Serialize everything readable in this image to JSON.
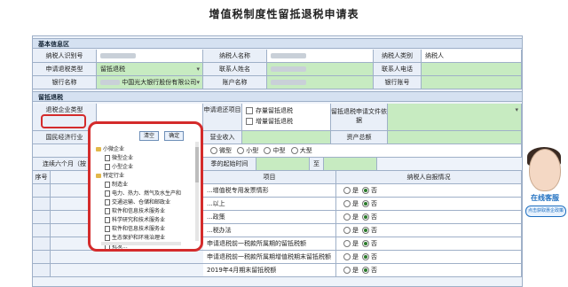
{
  "title": "增值税制度性留抵退税申请表",
  "section_basic": "基本信息区",
  "row1": {
    "l1": "纳税人识别号",
    "l2": "纳税人名称",
    "l3": "纳税人类别",
    "v3": "纳税人"
  },
  "row2": {
    "l1": "申请退税类型",
    "v1": "留抵退税",
    "l2": "联系人姓名",
    "l3": "联系人电话"
  },
  "row3": {
    "l1": "银行名称",
    "v1": "中国光大银行股份有限公司",
    "l2": "账户名称",
    "l3": "银行账号"
  },
  "section_refund": "留抵退税",
  "refund": {
    "enterprise_type": "退税企业类型",
    "apply_item": "申请退还项目",
    "opt1": "存量留抵退税",
    "opt2": "增量留抵退税",
    "basis": "留抵退税申请文件依据",
    "industry": "国民经济行业",
    "revenue": "营业收入",
    "assets": "资产总额",
    "size_micro": "微型",
    "size_small": "小型",
    "size_mid": "中型",
    "size_large": "大型",
    "consecutive": "连续六个月（按",
    "start_time": "季的起始时间",
    "to": "至"
  },
  "table": {
    "no": "序号",
    "item": "项目",
    "self_check": "纳税人自报情况",
    "rows": [
      {
        "item": "...增值税专用发票情形",
        "yes": "是",
        "no": "否"
      },
      {
        "item": "...以上",
        "yes": "是",
        "no": "否"
      },
      {
        "item": "...政策",
        "yes": "是",
        "no": "否"
      },
      {
        "item": "...税办法",
        "yes": "是",
        "no": "否"
      },
      {
        "item": "申请退税前一税款所属期的留抵税额",
        "yes": "是",
        "no": "否"
      },
      {
        "item": "申请退税前一税款所属期增值税期末留抵税额",
        "yes": "是",
        "no": "否"
      },
      {
        "item": "2019年4月期末留抵税额",
        "yes": "是",
        "no": "否"
      }
    ]
  },
  "popup": {
    "clear": "清空",
    "ok": "确定",
    "tree": [
      {
        "t": "小微企业",
        "lvl": 0,
        "folder": true
      },
      {
        "t": "微型企业",
        "lvl": 1,
        "folder": false
      },
      {
        "t": "小型企业",
        "lvl": 1,
        "folder": false
      },
      {
        "t": "特定行业",
        "lvl": 0,
        "folder": true
      },
      {
        "t": "制造业",
        "lvl": 1,
        "folder": false
      },
      {
        "t": "电力、热力、燃气及水生产和",
        "lvl": 1,
        "folder": false
      },
      {
        "t": "交通运输、仓储和邮政业",
        "lvl": 1,
        "folder": false
      },
      {
        "t": "软件和信息技术服务业",
        "lvl": 1,
        "folder": false
      },
      {
        "t": "科学研究和技术服务业",
        "lvl": 1,
        "folder": false
      },
      {
        "t": "软件和信息技术服务业",
        "lvl": 1,
        "folder": false
      },
      {
        "t": "生态保护和环境治理业",
        "lvl": 1,
        "folder": false
      },
      {
        "t": "批发...",
        "lvl": 1,
        "folder": false
      }
    ]
  },
  "service": {
    "label": "在线客服",
    "button": "点击获取惠企政策"
  }
}
